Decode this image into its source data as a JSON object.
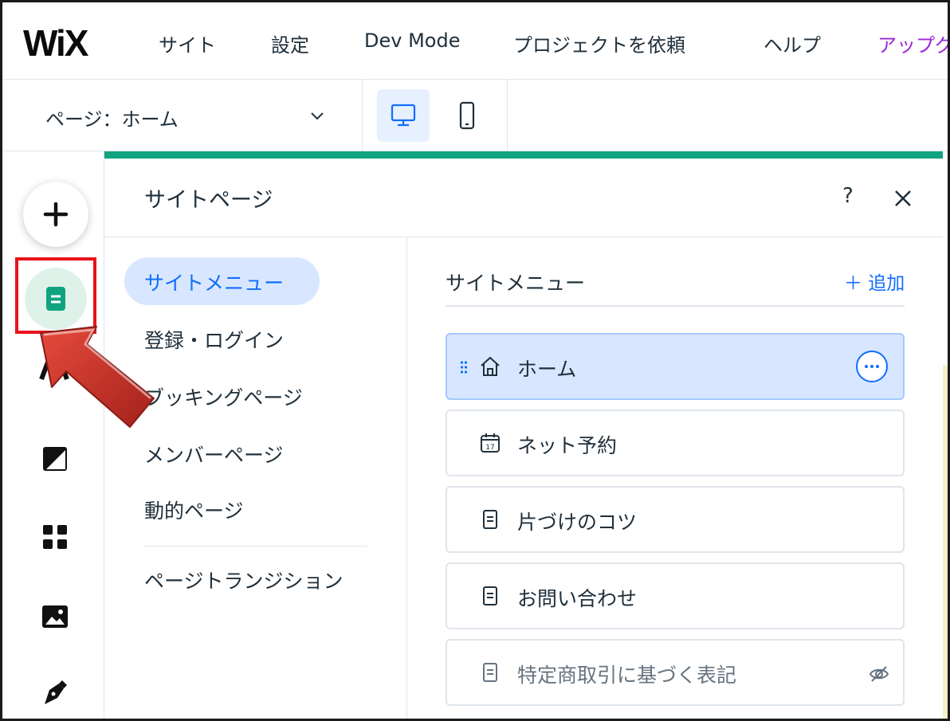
{
  "topbar": {
    "logo": "WiX",
    "menu": [
      {
        "label": "サイト"
      },
      {
        "label": "設定"
      },
      {
        "label": "Dev Mode"
      },
      {
        "label": "プロジェクトを依頼"
      },
      {
        "label": "ヘルプ"
      },
      {
        "label": "アップグ"
      }
    ]
  },
  "subbar": {
    "page_select_label": "ページ：ホーム",
    "devices": [
      {
        "icon": "desktop-icon",
        "active": true
      },
      {
        "icon": "mobile-icon",
        "active": false
      }
    ]
  },
  "rail": {
    "items": [
      {
        "icon": "add-icon"
      },
      {
        "icon": "pages-icon"
      },
      {
        "icon": "text-icon"
      },
      {
        "icon": "theme-icon"
      },
      {
        "icon": "apps-icon"
      },
      {
        "icon": "media-icon"
      },
      {
        "icon": "pen-icon"
      }
    ]
  },
  "panel": {
    "title": "サイトページ",
    "help": "?",
    "nav": [
      {
        "label": "サイトメニュー",
        "active": true
      },
      {
        "label": "登録・ログイン"
      },
      {
        "label": "ブッキングページ"
      },
      {
        "label": "メンバーページ"
      },
      {
        "label": "動的ページ"
      },
      {
        "label": "ページトランジション"
      }
    ],
    "content_title": "サイトメニュー",
    "add_label": "＋ 追加",
    "pages": [
      {
        "label": "ホーム",
        "icon": "home-icon",
        "selected": true
      },
      {
        "label": "ネット予約",
        "icon": "calendar-icon"
      },
      {
        "label": "片づけのコツ",
        "icon": "page-icon"
      },
      {
        "label": "お問い合わせ",
        "icon": "page-icon"
      },
      {
        "label": "特定商取引に基づく表記",
        "icon": "page-icon",
        "hidden": true
      }
    ]
  },
  "colors": {
    "accent": "#116dff",
    "upgrade": "#9a27d5",
    "pages_green": "#10a37f",
    "highlight_red": "#e8131b",
    "arrow_red": "#c9302c"
  }
}
